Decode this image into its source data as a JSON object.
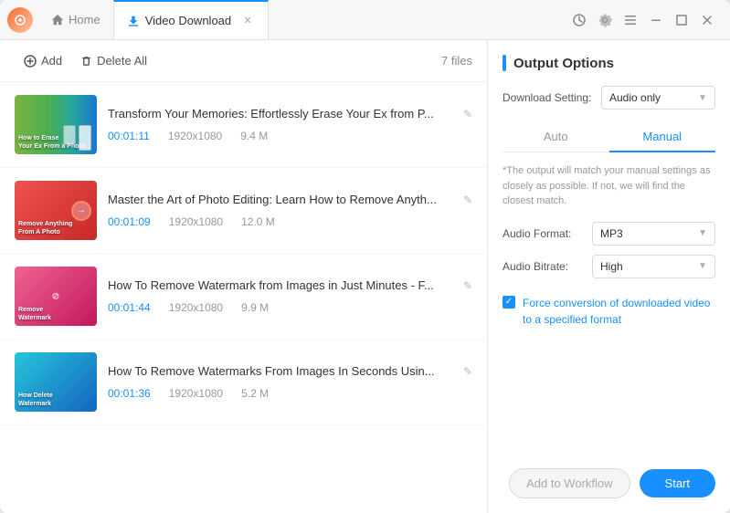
{
  "window": {
    "title": "Video Download",
    "home_tab": "Home"
  },
  "toolbar": {
    "add_label": "Add",
    "delete_label": "Delete All",
    "file_count": "7 files"
  },
  "videos": [
    {
      "id": 1,
      "title": "Transform Your Memories: Effortlessly Erase Your Ex from P...",
      "duration": "00:01:11",
      "resolution": "1920x1080",
      "size": "9.4 M",
      "thumb_class": "thumb-1"
    },
    {
      "id": 2,
      "title": "Master the Art of Photo Editing: Learn How to Remove Anyth...",
      "duration": "00:01:09",
      "resolution": "1920x1080",
      "size": "12.0 M",
      "thumb_class": "thumb-2"
    },
    {
      "id": 3,
      "title": "How To Remove Watermark from Images in Just Minutes - F...",
      "duration": "00:01:44",
      "resolution": "1920x1080",
      "size": "9.9 M",
      "thumb_class": "thumb-3"
    },
    {
      "id": 4,
      "title": "How To Remove Watermarks From Images In Seconds Usin...",
      "duration": "00:01:36",
      "resolution": "1920x1080",
      "size": "5.2 M",
      "thumb_class": "thumb-4"
    }
  ],
  "output_options": {
    "title": "Output Options",
    "download_setting_label": "Download Setting:",
    "download_setting_value": "Audio only",
    "tab_auto": "Auto",
    "tab_manual": "Manual",
    "note": "*The output will match your manual settings as closely as possible. If not, we will find the closest match.",
    "audio_format_label": "Audio Format:",
    "audio_format_value": "MP3",
    "audio_bitrate_label": "Audio Bitrate:",
    "audio_bitrate_value": "High",
    "force_convert_label": "Force conversion of downloaded video to a specified format"
  },
  "bottom": {
    "workflow_btn": "Add to Workflow",
    "start_btn": "Start"
  }
}
